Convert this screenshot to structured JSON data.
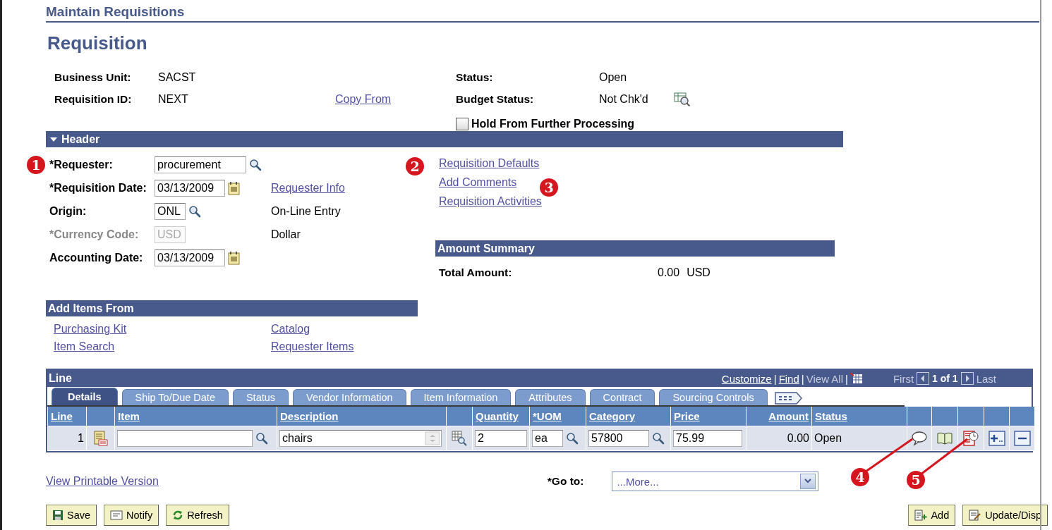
{
  "page_title": "Maintain Requisitions",
  "heading": "Requisition",
  "info": {
    "business_unit": {
      "label": "Business Unit:",
      "value": "SACST"
    },
    "requisition_id": {
      "label": "Requisition ID:",
      "value": "NEXT"
    },
    "copy_from": "Copy From",
    "status": {
      "label": "Status:",
      "value": "Open"
    },
    "budget_status": {
      "label": "Budget Status:",
      "value": "Not Chk'd"
    },
    "hold": {
      "label": "Hold From Further Processing",
      "checked": false
    }
  },
  "header": {
    "title": "Header",
    "expanded": true,
    "fields": [
      {
        "label": "*Requester:",
        "value": "procurement",
        "kind": "lookup",
        "disabled": false
      },
      {
        "label": "*Requisition Date:",
        "value": "03/13/2009",
        "kind": "date",
        "disabled": false,
        "link": "Requester Info"
      },
      {
        "label": "Origin:",
        "value": "ONL",
        "kind": "lookup",
        "disabled": false,
        "description": "On-Line Entry"
      },
      {
        "label": "*Currency Code:",
        "value": "USD",
        "kind": "plain",
        "disabled": true,
        "description": "Dollar"
      },
      {
        "label": "Accounting Date:",
        "value": "03/13/2009",
        "kind": "date",
        "disabled": false
      }
    ],
    "links": [
      "Requisition Defaults",
      "Add Comments",
      "Requisition Activities"
    ]
  },
  "amount_summary": {
    "title": "Amount Summary",
    "label": "Total Amount:",
    "value": "0.00",
    "currency": "USD"
  },
  "add_items": {
    "title": "Add Items From",
    "links": [
      "Purchasing Kit",
      "Catalog",
      "Item Search",
      "Requester Items"
    ]
  },
  "line_grid": {
    "title": "Line",
    "nav": [
      {
        "kind": "link",
        "text": "Customize"
      },
      {
        "kind": "sep",
        "text": "|"
      },
      {
        "kind": "link",
        "text": "Find"
      },
      {
        "kind": "sep",
        "text": "|"
      },
      {
        "kind": "muted",
        "text": "View All"
      },
      {
        "kind": "sep",
        "text": "|"
      }
    ],
    "pager": {
      "first": "First",
      "count": "1 of 1",
      "last": "Last"
    },
    "tabs": [
      {
        "label": "Details",
        "selected": true
      },
      {
        "label": "Ship To/Due Date",
        "selected": false
      },
      {
        "label": "Status",
        "selected": false
      },
      {
        "label": "Vendor Information",
        "selected": false
      },
      {
        "label": "Item Information",
        "selected": false
      },
      {
        "label": "Attributes",
        "selected": false
      },
      {
        "label": "Contract",
        "selected": false
      },
      {
        "label": "Sourcing Controls",
        "selected": false
      }
    ],
    "columns": [
      {
        "kind": "text",
        "label": "Line"
      },
      {
        "kind": "blank"
      },
      {
        "kind": "text",
        "label": "Item"
      },
      {
        "kind": "text",
        "label": "Description"
      },
      {
        "kind": "blank"
      },
      {
        "kind": "text",
        "label": "Quantity"
      },
      {
        "kind": "text",
        "label": "*UOM"
      },
      {
        "kind": "text",
        "label": "Category"
      },
      {
        "kind": "text",
        "label": "Price"
      },
      {
        "kind": "text",
        "label": "Amount"
      },
      {
        "kind": "text",
        "label": "Status"
      },
      {
        "kind": "blank"
      },
      {
        "kind": "blank"
      },
      {
        "kind": "blank"
      },
      {
        "kind": "blank"
      },
      {
        "kind": "blank"
      }
    ],
    "rows": [
      {
        "line": "1",
        "description": "chairs",
        "quantity": "2",
        "uom": "ea",
        "category": "57800",
        "price": "75.99",
        "amount": "0.00",
        "status": "Open"
      }
    ]
  },
  "view_printable": "View Printable Version",
  "goto": {
    "label": "*Go to:",
    "value": "...More..."
  },
  "buttons_left": [
    {
      "label": "Save",
      "kind": "save"
    },
    {
      "label": "Notify",
      "kind": "notify"
    },
    {
      "label": "Refresh",
      "kind": "refresh"
    }
  ],
  "buttons_right": [
    {
      "label": "Add",
      "kind": "add"
    },
    {
      "label": "Update/Disp",
      "kind": "update"
    }
  ],
  "callouts": [
    "1",
    "2",
    "3",
    "4",
    "5"
  ]
}
